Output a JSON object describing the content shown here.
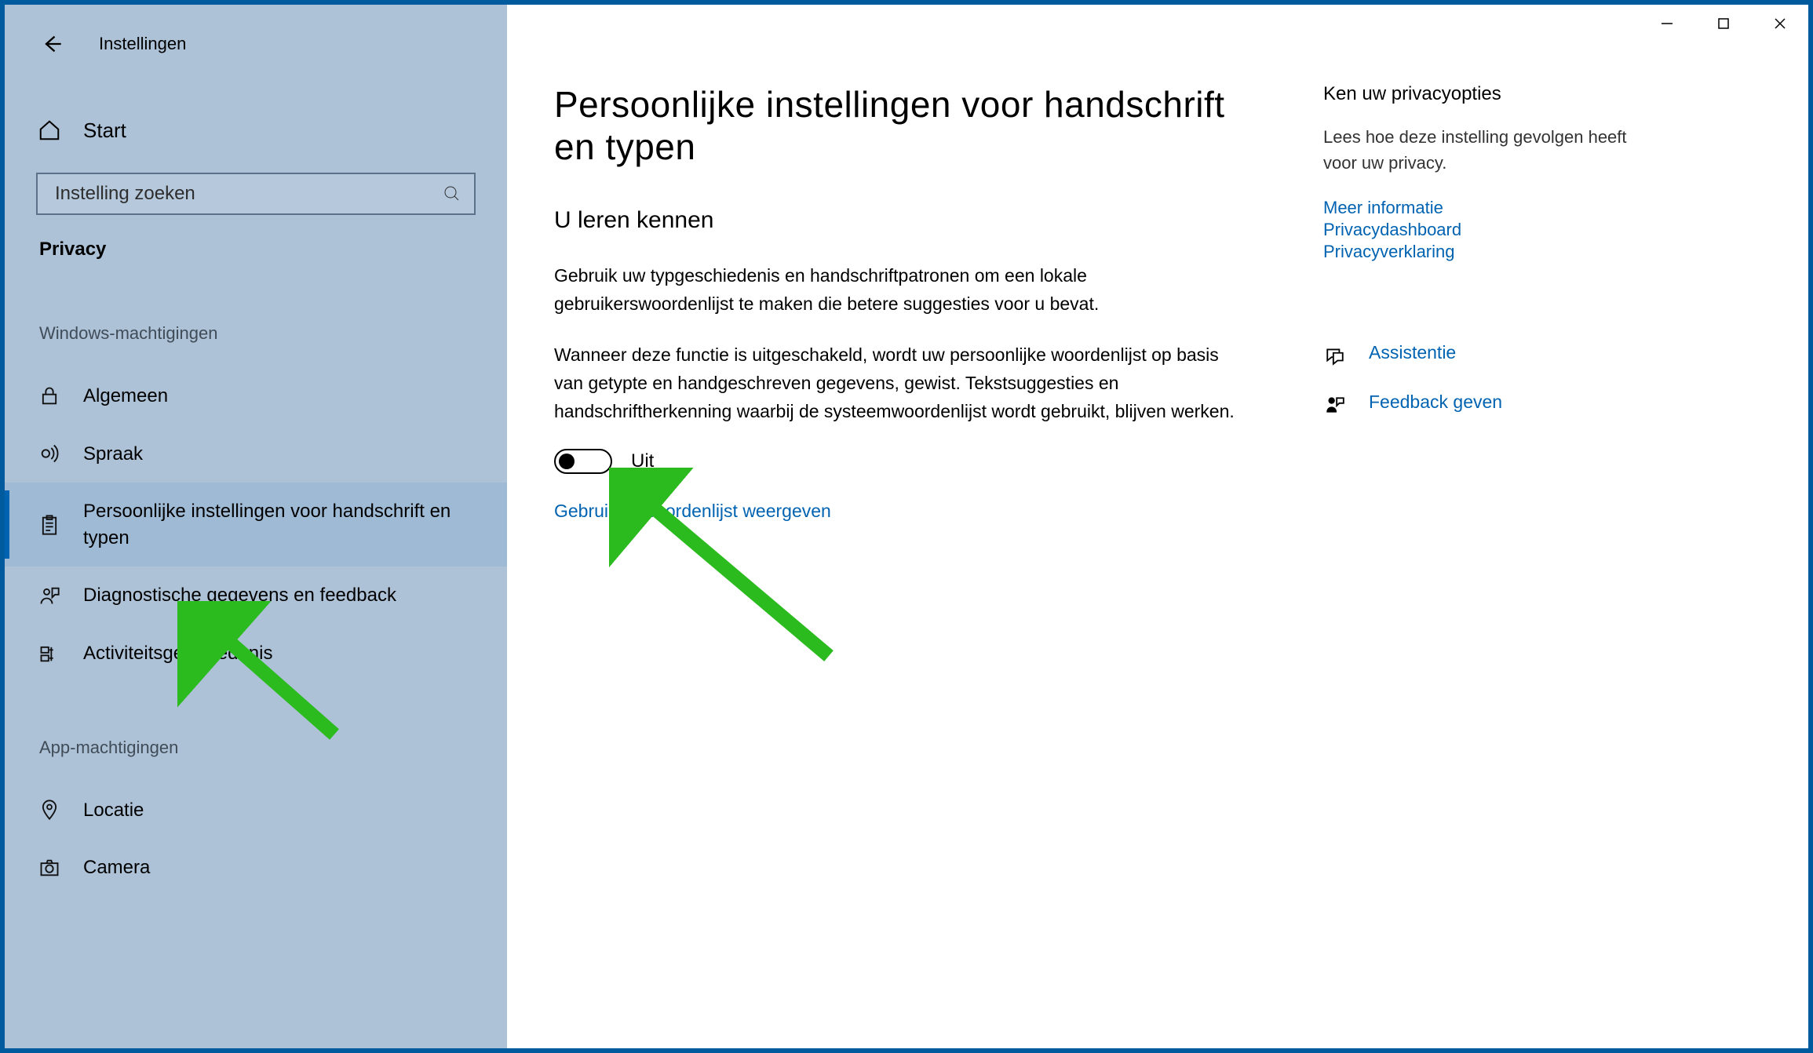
{
  "titlebar": {
    "app_title": "Instellingen"
  },
  "sidebar": {
    "home_label": "Start",
    "search_placeholder": "Instelling zoeken",
    "section_label": "Privacy",
    "group1": "Windows-machtigingen",
    "items1": [
      {
        "label": "Algemeen"
      },
      {
        "label": "Spraak"
      },
      {
        "label": "Persoonlijke instellingen voor handschrift en typen"
      },
      {
        "label": "Diagnostische gegevens en feedback"
      },
      {
        "label": "Activiteitsgeschiedenis"
      }
    ],
    "group2": "App-machtigingen",
    "items2": [
      {
        "label": "Locatie"
      },
      {
        "label": "Camera"
      }
    ]
  },
  "main": {
    "heading": "Persoonlijke instellingen voor handschrift en typen",
    "sub": "U leren kennen",
    "p1": "Gebruik uw typgeschiedenis en handschriftpatronen om een lokale gebruikerswoordenlijst te maken die betere suggesties voor u bevat.",
    "p2": "Wanneer deze functie is uitgeschakeld, wordt uw persoonlijke woordenlijst op basis van getypte en handgeschreven gegevens, gewist. Tekstsuggesties en handschriftherkenning waarbij de systeemwoordenlijst wordt gebruikt, blijven werken.",
    "toggle_state": "off",
    "toggle_label": "Uit",
    "dictionary_link": "Gebruikerswoordenlijst weergeven"
  },
  "right": {
    "heading": "Ken uw privacyopties",
    "text": "Lees hoe deze instelling gevolgen heeft voor uw privacy.",
    "links": [
      "Meer informatie",
      "Privacydashboard",
      "Privacyverklaring"
    ],
    "help1": "Assistentie",
    "help2": "Feedback geven"
  }
}
